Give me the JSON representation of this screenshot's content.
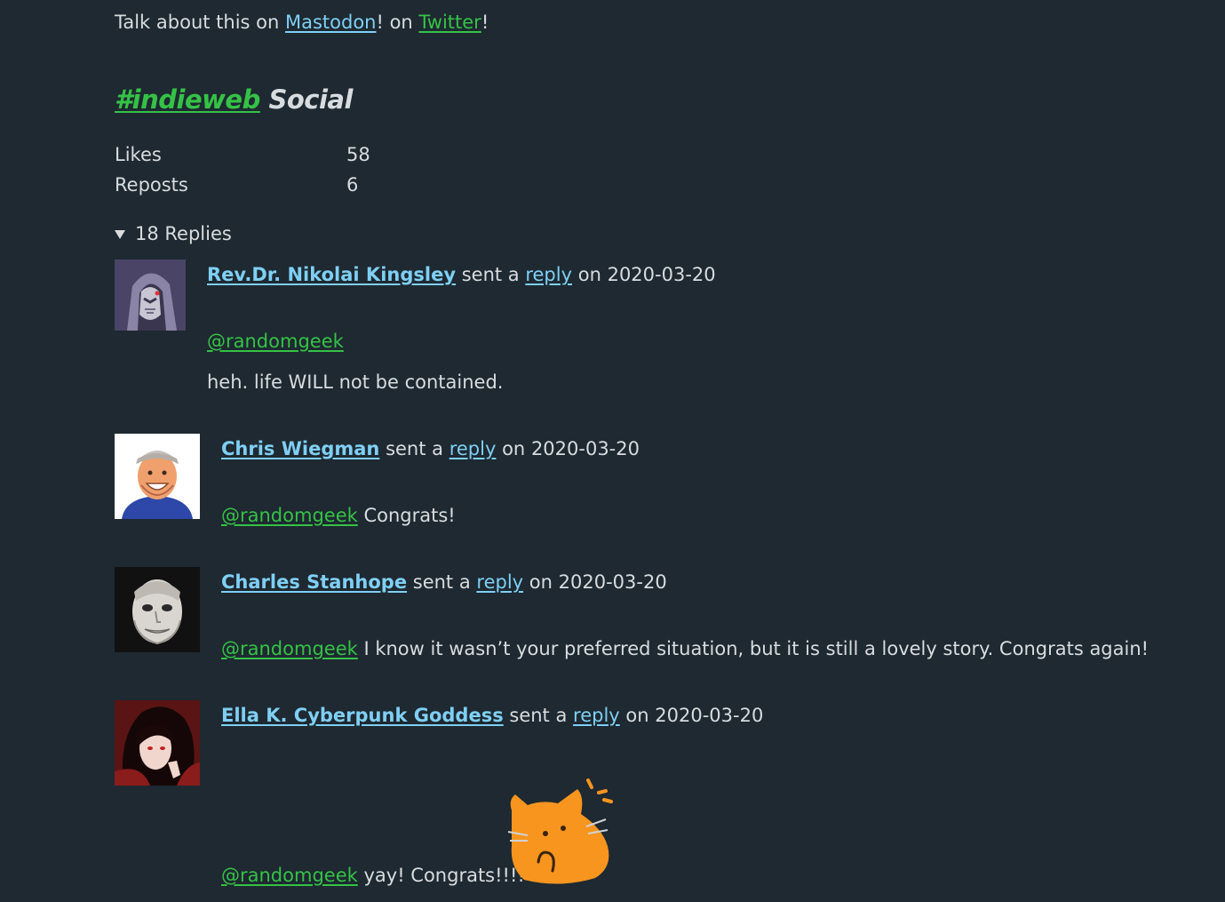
{
  "talk": {
    "prefix": "Talk about this on ",
    "mastodon": "Mastodon",
    "middle": "! on ",
    "twitter": "Twitter",
    "suffix": "!"
  },
  "social": {
    "hashtag": "#indieweb",
    "title": "Social"
  },
  "stats": [
    {
      "label": "Likes",
      "value": "58"
    },
    {
      "label": "Reposts",
      "value": "6"
    }
  ],
  "replies_toggle": "18 Replies",
  "reply_sentence": {
    "sent_a": "sent a",
    "reply": "reply",
    "on": "on"
  },
  "replies": [
    {
      "author": "Rev.Dr. Nikolai Kingsley",
      "date": "2020-03-20",
      "mention": "@randomgeek",
      "text": "heh. life WILL not be contained."
    },
    {
      "author": "Chris Wiegman",
      "date": "2020-03-20",
      "mention": "@randomgeek",
      "text": "Congrats!"
    },
    {
      "author": "Charles Stanhope",
      "date": "2020-03-20",
      "mention": "@randomgeek",
      "text": "I know it wasn’t your preferred situation, but it is still a lovely story. Congrats again!"
    },
    {
      "author": "Ella K. Cyberpunk Goddess",
      "date": "2020-03-20",
      "mention": "@randomgeek",
      "text": "yay! Congrats!!!!",
      "emoji": "blobcat-shocked-icon"
    }
  ],
  "colors": {
    "background": "#1e2931",
    "text": "#d8dcdf",
    "link_blue": "#7fcff4",
    "link_green": "#35c246",
    "cat_orange": "#f7951f"
  }
}
